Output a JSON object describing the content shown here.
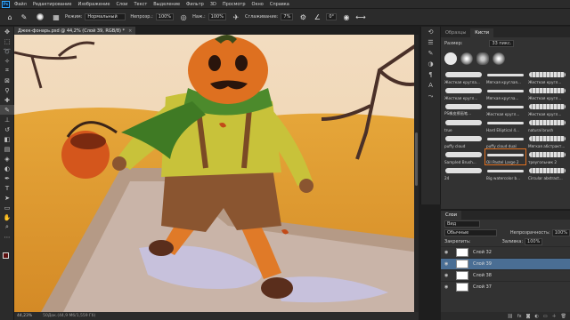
{
  "menu": {
    "logo": "Ps",
    "items": [
      "Файл",
      "Редактирование",
      "Изображение",
      "Слои",
      "Текст",
      "Выделение",
      "Фильтр",
      "3D",
      "Просмотр",
      "Окно",
      "Справка"
    ]
  },
  "options": {
    "mode_label": "Режим:",
    "mode_value": "Нормальный",
    "opacity_label": "Непрозр.:",
    "opacity_value": "100%",
    "pressure_label": "Наж.:",
    "pressure_value": "100%",
    "smoothing_label": "Сглаживание:",
    "smoothing_value": "7%",
    "angle_value": "0°"
  },
  "document": {
    "tab_title": "Джек-фонарь.psd @ 44,2% (Слой 39, RGB/8) *",
    "close": "×"
  },
  "status": {
    "zoom": "44,23%",
    "doc_info": "50Док.(44,9 Мб/1,559 Гб)"
  },
  "brushes_panel": {
    "tab_samples": "Образцы",
    "tab_brushes": "Кисти",
    "size_label": "Размер:",
    "size_value": "33 пикс.",
    "brushes": [
      "Жесткая кругла...",
      "Мягкая круглая...",
      "Жесткая кругл...",
      "Жесткая кругл...",
      "Мягкая кругла...",
      "Жесткая кругл...",
      "PS橡皮擦画笔...",
      "Жесткая кругл...",
      "Жесткая кругл...",
      "true",
      "Hard Elliptical 4...",
      "natural brush",
      "puffy cloud",
      "puffy cloud dual",
      "Мягкая абстракт...",
      "Sampled Brush...",
      "Oil Pastel Large 2",
      "треугольник 2",
      "24",
      "Big watercolor b...",
      "Circular abstract..."
    ],
    "selected_index": 16
  },
  "layers_panel": {
    "tab": "Слои",
    "search_placeholder": "Вид",
    "blend_mode": "Обычные",
    "opacity_label": "Непрозрачность:",
    "opacity_value": "100%",
    "lock_label": "Закрепить:",
    "fill_label": "Заливка:",
    "fill_value": "100%",
    "layers": [
      "Слой 32",
      "Слой 39",
      "Слой 38",
      "Слой 37"
    ],
    "selected_index": 1
  },
  "colors": {
    "foreground": "#5c1010",
    "background": "#ffffff",
    "accent": "#31a8ff",
    "layer_selected": "#4a6e94"
  }
}
